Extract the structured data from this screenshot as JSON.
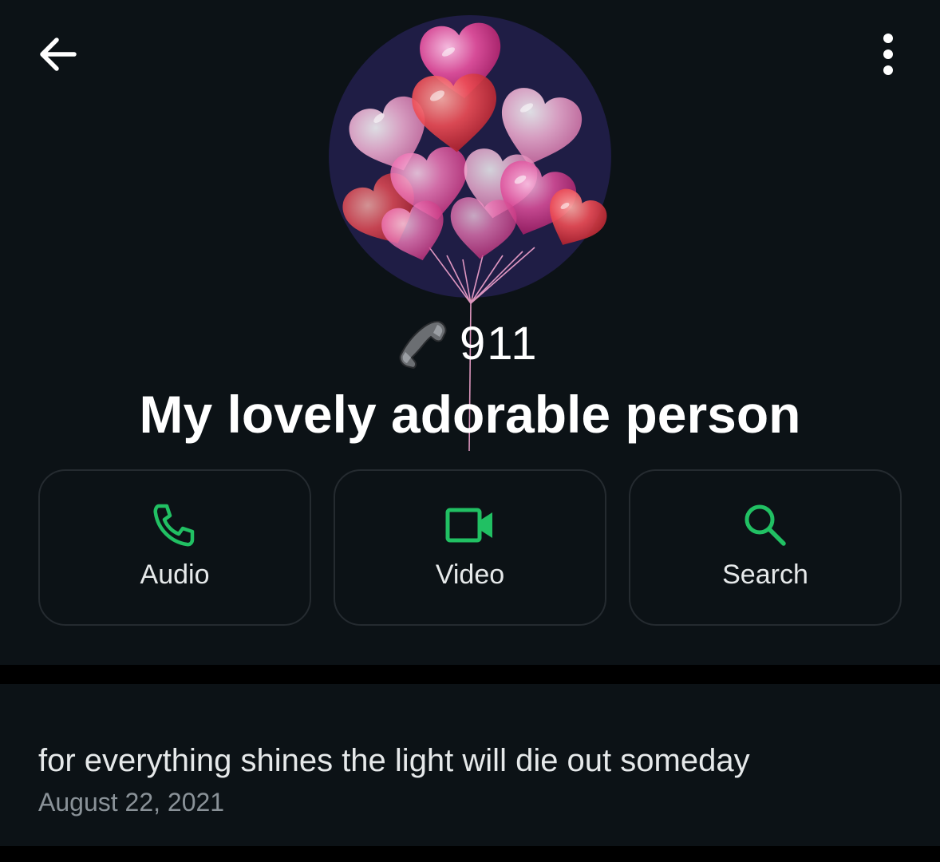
{
  "header": {
    "back_icon": "arrow-left-icon",
    "menu_icon": "more-vertical-icon"
  },
  "profile": {
    "avatar_description_icon": "heart-balloons",
    "phone_icon": "telephone-receiver-icon",
    "phone_number": "911",
    "name": "My lovely adorable person"
  },
  "actions": [
    {
      "label": "Audio",
      "icon": "phone-icon"
    },
    {
      "label": "Video",
      "icon": "video-camera-icon"
    },
    {
      "label": "Search",
      "icon": "search-icon"
    }
  ],
  "about": {
    "text": "for everything shines the light will die out someday",
    "date": "August 22, 2021"
  },
  "colors": {
    "accent": "#21c063",
    "background": "#0c1216",
    "divider": "#000000",
    "card_border": "#252b30",
    "text_primary": "#ffffff",
    "text_secondary": "#8a9298",
    "avatar_bg": "#1f1d45"
  }
}
